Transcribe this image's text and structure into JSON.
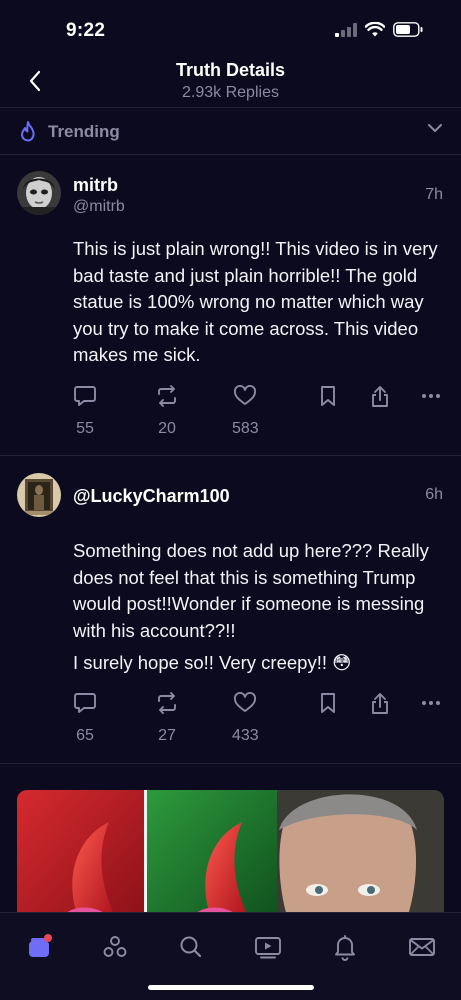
{
  "status_bar": {
    "time": "9:22"
  },
  "header": {
    "title": "Truth Details",
    "subtitle": "2.93k Replies"
  },
  "trending": {
    "label": "Trending"
  },
  "posts": [
    {
      "display_name": "mitrb",
      "handle": "@mitrb",
      "time": "7h",
      "paragraphs": [
        "This is just plain wrong!! This video is in very bad taste and just plain horrible!! The gold statue is 100% wrong no matter which way you try to make it come across. This video makes me sick."
      ],
      "replies": "55",
      "retruths": "20",
      "likes": "583"
    },
    {
      "display_name": "@LuckyCharm100",
      "handle": "",
      "time": "6h",
      "paragraphs": [
        "Something does not add up here??? Really does not feel that this is something Trump would post!!Wonder if someone is messing with his account??!!",
        "I surely hope so!! Very creepy!! 😳"
      ],
      "replies": "65",
      "retruths": "27",
      "likes": "433"
    }
  ],
  "icons": {
    "back": "chevron-left-icon",
    "trending": "flame-icon",
    "expand": "chevron-down-icon",
    "reply": "speech-bubble-icon",
    "retruth": "repost-icon",
    "like": "heart-icon",
    "bookmark": "bookmark-icon",
    "share": "share-icon",
    "more": "ellipsis-icon"
  },
  "tabs": [
    "home-icon",
    "groups-icon",
    "search-icon",
    "video-icon",
    "notifications-icon",
    "messages-icon"
  ],
  "colors": {
    "background": "#0b0a1e",
    "accent": "#6f6cf6",
    "badge": "#e8475a",
    "secondary_text": "#8d8aa3",
    "divider": "#23223a"
  }
}
